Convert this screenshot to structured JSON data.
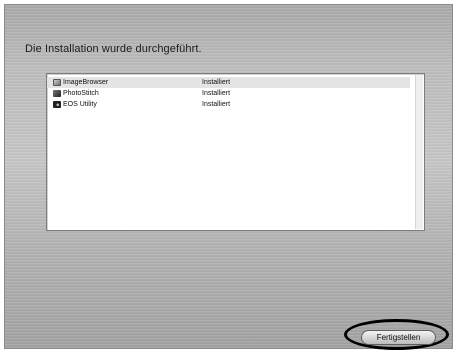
{
  "dialog": {
    "title": "Die Installation wurde durchgeführt."
  },
  "list": {
    "items": [
      {
        "name": "ImageBrowser",
        "status": "Installiert",
        "icon": "imagebrowser-app-icon"
      },
      {
        "name": "PhotoStitch",
        "status": "Installiert",
        "icon": "photostitch-app-icon"
      },
      {
        "name": "EOS Utility",
        "status": "Installiert",
        "icon": "eos-utility-app-icon"
      }
    ]
  },
  "footer": {
    "finish_label": "Fertigstellen"
  },
  "colors": {
    "selection": "#e4e4e4",
    "highlight_ring": "#000000"
  }
}
